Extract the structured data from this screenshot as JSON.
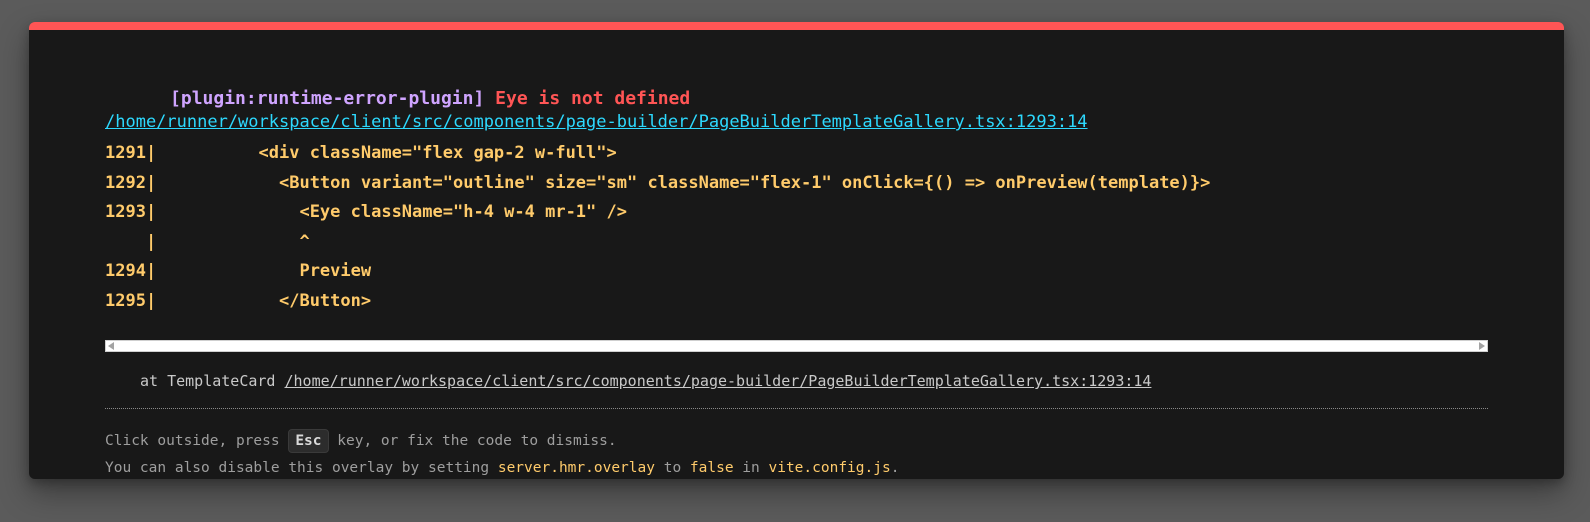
{
  "error": {
    "plugin": "[plugin:runtime-error-plugin]",
    "message": "Eye is not defined",
    "file": "/home/runner/workspace/client/src/components/page-builder/PageBuilderTemplateGallery.tsx:1293:14",
    "frame_lines": [
      "1291|          <div className=\"flex gap-2 w-full\">",
      "1292|            <Button variant=\"outline\" size=\"sm\" className=\"flex-1\" onClick={() => onPreview(template)}>",
      "1293|              <Eye className=\"h-4 w-4 mr-1\" />",
      "    |              ^",
      "1294|              Preview",
      "1295|            </Button>"
    ],
    "stack_prefix": "at TemplateCard ",
    "stack_file": "/home/runner/workspace/client/src/components/page-builder/PageBuilderTemplateGallery.tsx:1293:14"
  },
  "tip": {
    "line1_before": "Click outside, press ",
    "line1_key": "Esc",
    "line1_after": " key, or fix the code to dismiss.",
    "line2_before": "You can also disable this overlay by setting ",
    "line2_setting": "server.hmr.overlay",
    "line2_to": " to ",
    "line2_value": "false",
    "line2_in": " in ",
    "line2_config": "vite.config.js",
    "line2_end": "."
  },
  "colors": {
    "accent": "#ff5555",
    "plugin": "#cfa4ff",
    "link": "#2dd9fe",
    "code": "#ffcb6b",
    "background": "#181818"
  }
}
